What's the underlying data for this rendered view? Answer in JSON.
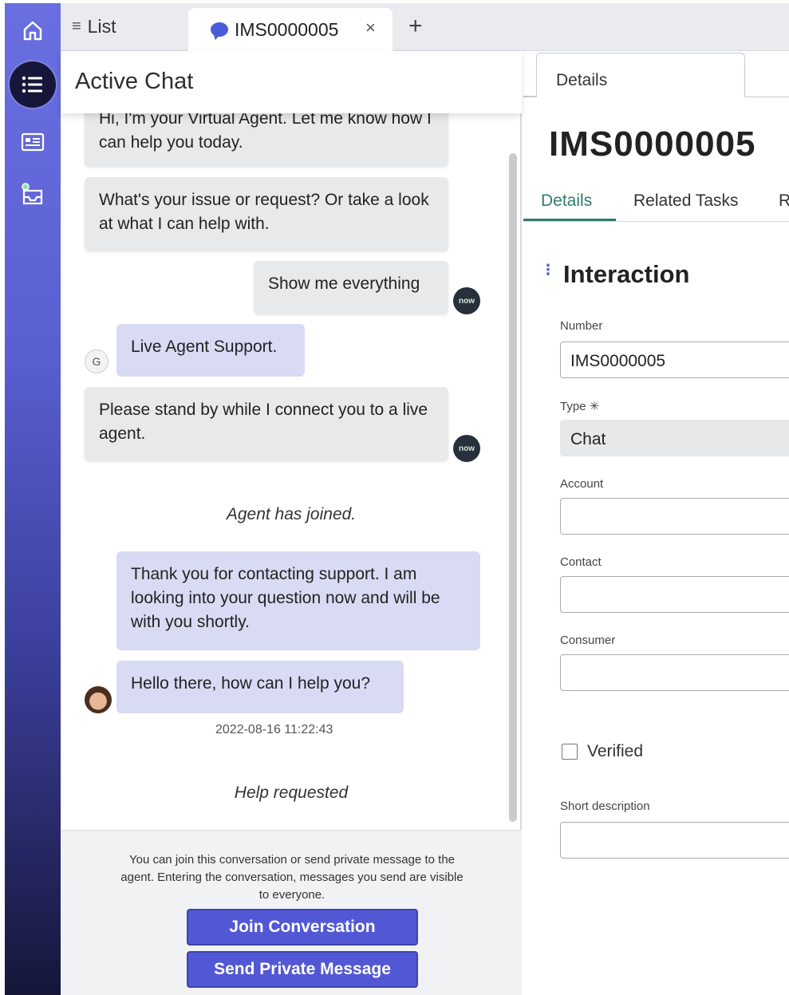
{
  "tabs": {
    "list_label": "List",
    "active_label": "IMS0000005",
    "close_glyph": "×",
    "add_glyph": "+"
  },
  "chat": {
    "header_title": "Active Chat",
    "messages": [
      {
        "id": "m1",
        "text": "Hi, I'm your Virtual Agent. Let me know how I can help you today."
      },
      {
        "id": "m2",
        "text": "What's your issue or request? Or take a look at what I can help with."
      },
      {
        "id": "m3",
        "text": "Show me everything"
      },
      {
        "id": "m4",
        "text": "Live Agent Support."
      },
      {
        "id": "m5",
        "text": "Please stand by while I connect you to a live agent."
      },
      {
        "id": "m6",
        "text": "Agent has joined."
      },
      {
        "id": "m7",
        "text": "Thank you for contacting support. I am looking into your question now and will be with you shortly."
      },
      {
        "id": "m8",
        "text": "Hello there, how can I help you?"
      },
      {
        "id": "m9",
        "text": "2022-08-16 11:22:43"
      },
      {
        "id": "m10",
        "text": "Help requested"
      }
    ],
    "avatar_now_label": "now",
    "avatar_g_label": "G",
    "footer_note": "You can join this conversation or send private message to the agent. Entering the conversation, messages you send are visible to everyone.",
    "join_button": "Join Conversation",
    "private_button": "Send Private Message"
  },
  "details": {
    "tab_label": "Details",
    "record_number": "IMS0000005",
    "subtabs": [
      "Details",
      "Related Tasks",
      "R"
    ],
    "section_title": "Interaction",
    "fields": {
      "number_label": "Number",
      "number_value": "IMS0000005",
      "type_label": "Type ✳",
      "type_value": "Chat",
      "account_label": "Account",
      "account_value": "",
      "contact_label": "Contact",
      "contact_value": "",
      "consumer_label": "Consumer",
      "consumer_value": "",
      "verified_label": "Verified",
      "short_desc_label": "Short description",
      "short_desc_value": ""
    }
  },
  "colors": {
    "accent": "#5258d4",
    "selected_tab": "#2f7a6e",
    "agent_bubble": "#d9dbf4",
    "bot_bubble": "#e8e9eb"
  },
  "icons": [
    "home-icon",
    "list-icon",
    "dashboard-icon",
    "inbox-icon",
    "chat-bubble-icon",
    "close-icon",
    "add-icon",
    "drag-handle-icon"
  ]
}
